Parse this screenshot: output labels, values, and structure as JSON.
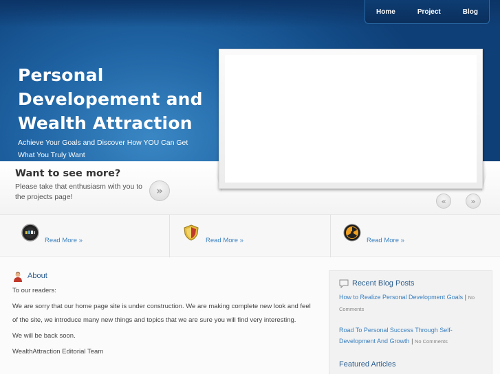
{
  "nav": {
    "items": [
      "Home",
      "Project",
      "Blog"
    ]
  },
  "hero": {
    "headline": "Personal Developement and Wealth Attraction",
    "tagline": "Achieve Your Goals and Discover How YOU Can Get What You Truly Want"
  },
  "promo": {
    "title": "Want to see more?",
    "text": "Please take that enthusiasm with you to the projects page!",
    "next_glyph": "»",
    "prev_glyph": "«"
  },
  "features": [
    {
      "icon": "speedometer-icon",
      "link": "Read More »"
    },
    {
      "icon": "shield-icon",
      "link": "Read More »"
    },
    {
      "icon": "radiation-icon",
      "link": "Read More »"
    }
  ],
  "about": {
    "title": "About",
    "paragraphs": [
      "To our readers:",
      "We are sorry that our home page site is under construction. We are making  complete new look and feel of the site, we introduce many new things and topics that we are sure you will find very interesting.",
      "We will be back soon.",
      "WealthAttraction Editorial Team"
    ]
  },
  "sidebar": {
    "recent_title": "Recent Blog Posts",
    "posts": [
      {
        "title": "How to Realize Personal Development Goals",
        "separator": "|",
        "comments": "No Comments"
      },
      {
        "title": "Road To Personal Success Through Self-Development And Growth",
        "separator": "|",
        "comments": "No Comments"
      }
    ],
    "featured_title": "Featured Articles"
  },
  "colors": {
    "hero_blue": "#1f63a3",
    "link_blue": "#3c82c0",
    "title_blue": "#2a5d8f"
  }
}
